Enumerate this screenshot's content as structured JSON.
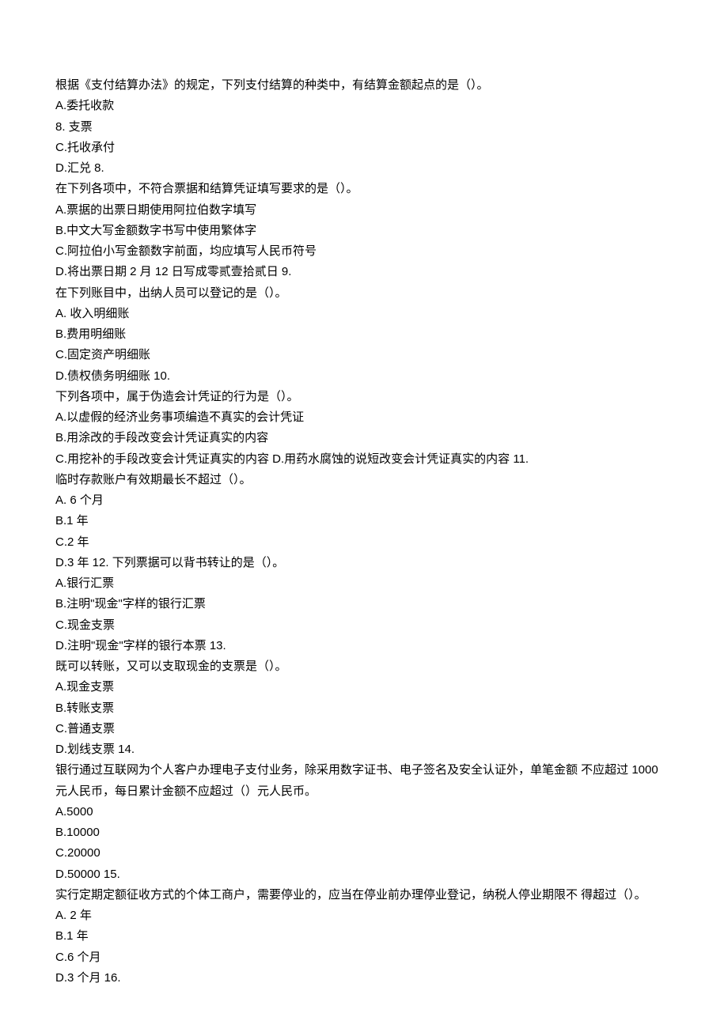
{
  "lines": [
    "根据《支付结算办法》的规定，下列支付结算的种类中，有结算金额起点的是（）。",
    "A.委托收款",
    "8. 支票",
    "C.托收承付",
    "D.汇兑 8.",
    "在下列各项中，不符合票据和结算凭证填写要求的是（）。",
    "A.票据的出票日期使用阿拉伯数字填写",
    "B.中文大写金额数字书写中使用繁体字",
    "C.阿拉伯小写金额数字前面，均应填写人民币符号",
    "D.将出票日期 2 月 12 日写成零贰壹拾贰日 9.",
    "在下列账目中，出纳人员可以登记的是（）。",
    "A. 收入明细账",
    "B.费用明细账",
    "C.固定资产明细账",
    "D.债权债务明细账 10.",
    "下列各项中，属于伪造会计凭证的行为是（）。",
    "A.以虚假的经济业务事项编造不真实的会计凭证",
    "B.用涂改的手段改变会计凭证真实的内容",
    "C.用挖补的手段改变会计凭证真实的内容 D.用药水腐蚀的说短改变会计凭证真实的内容 11.",
    "临时存款账户有效期最长不超过（）。",
    "A. 6 个月",
    "B.1 年",
    "C.2 年",
    "D.3 年 12. 下列票据可以背书转让的是（）。",
    "A.银行汇票",
    "B.注明\"现金\"字样的银行汇票",
    "C.现金支票",
    "D.注明\"现金\"字样的银行本票 13.",
    "既可以转账，又可以支取现金的支票是（）。",
    "A.现金支票",
    "B.转账支票",
    "C.普通支票",
    "D.划线支票 14.",
    "银行通过互联网为个人客户办理电子支付业务，除采用数字证书、电子签名及安全认证外，单笔金额 不应超过 1000 元人民币，每日累计金额不应超过（）元人民币。",
    "A.5000",
    "B.10000",
    "C.20000",
    "D.50000 15.",
    "实行定期定额征收方式的个体工商户，需要停业的，应当在停业前办理停业登记，纳税人停业期限不 得超过（）。",
    "A. 2 年",
    "B.1 年",
    "C.6 个月",
    "D.3 个月 16."
  ]
}
